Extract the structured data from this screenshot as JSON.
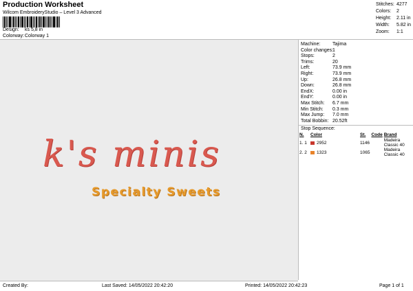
{
  "header": {
    "title": "Production Worksheet",
    "subtitle": "Wilcom EmbroideryStudio – Level 3 Advanced",
    "design_label": "Design:",
    "design_value": "ks 5,8 in",
    "colorway_label": "Colorway:",
    "colorway_value": "Colorway 1"
  },
  "stats": {
    "stitches_label": "Stitches:",
    "stitches": "4277",
    "colors_label": "Colors:",
    "colors": "2",
    "height_label": "Height:",
    "height": "2.11 in",
    "width_label": "Width:",
    "width": "5.82 in",
    "zoom_label": "Zoom:",
    "zoom": "1:1"
  },
  "design": {
    "main_text": "k's minis",
    "sub_text": "Specialty Sweets",
    "main_color": "#d9594f",
    "sub_color": "#e69a2c"
  },
  "machine": [
    {
      "label": "Machine:",
      "value": "Tajima"
    },
    {
      "label": "Color changes:",
      "value": "1"
    },
    {
      "label": "Stops:",
      "value": "2"
    },
    {
      "label": "Trims:",
      "value": "20"
    },
    {
      "label": "Left:",
      "value": "73.9 mm"
    },
    {
      "label": "Right:",
      "value": "73.9 mm"
    },
    {
      "label": "Up:",
      "value": "26.8 mm"
    },
    {
      "label": "Down:",
      "value": "26.8 mm"
    },
    {
      "label": "EndX:",
      "value": "0.00 in"
    },
    {
      "label": "EndY:",
      "value": "0.00 in"
    },
    {
      "label": "Max Stitch:",
      "value": "6.7 mm"
    },
    {
      "label": "Min Stitch:",
      "value": "0.3 mm"
    },
    {
      "label": "Max Jump:",
      "value": "7.0 mm"
    },
    {
      "label": "Total Bobbin:",
      "value": "20.52ft"
    }
  ],
  "stop_sequence": {
    "title": "Stop Sequence:",
    "headers": [
      "N.",
      "Color",
      "St.",
      "Code",
      "Brand"
    ],
    "rows": [
      {
        "n": "1.",
        "stop": "1",
        "swatch": "#c8372d",
        "color": "2952",
        "st": "1146",
        "brand": "Madeira Classic 40"
      },
      {
        "n": "2.",
        "stop": "2",
        "swatch": "#e8832a",
        "color": "1323",
        "st": "1065",
        "brand": "Madeira Classic 40"
      }
    ]
  },
  "footer": {
    "created": "Created By:",
    "saved": "Last Saved: 14/05/2022 20:42:20",
    "printed": "Printed: 14/05/2022 20:42:23",
    "page": "Page 1 of 1"
  }
}
